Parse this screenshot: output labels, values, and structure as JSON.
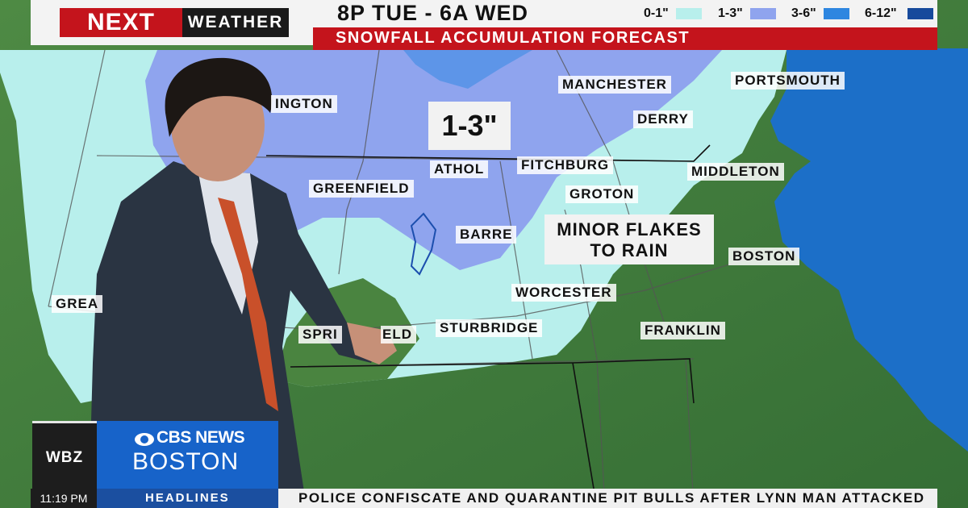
{
  "brand": {
    "next": "NEXT",
    "weather": "WEATHER",
    "station": "WBZ",
    "network_line1": "CBS NEWS",
    "network_line2": "BOSTON"
  },
  "forecast": {
    "time_range": "8P TUE - 6A WED",
    "subtitle": "SNOWFALL ACCUMULATION FORECAST",
    "big_callout": "1-3\"",
    "callout_line1": "MINOR FLAKES",
    "callout_line2": "TO RAIN"
  },
  "legend": [
    {
      "label": "0-1\"",
      "color": "#b8efec"
    },
    {
      "label": "1-3\"",
      "color": "#8fa4ee"
    },
    {
      "label": "3-6\"",
      "color": "#2e86e0"
    },
    {
      "label": "6-12\"",
      "color": "#174a9c"
    }
  ],
  "cities": {
    "bennington": "INGTON",
    "manchester": "MANCHESTER",
    "portsmouth": "PORTSMOUTH",
    "derry": "DERRY",
    "athol": "ATHOL",
    "fitchburg": "FITCHBURG",
    "middleton": "MIDDLETON",
    "greenfield": "GREENFIELD",
    "groton": "GROTON",
    "barre": "BARRE",
    "boston": "BOSTON",
    "worcester": "WORCESTER",
    "great_barrington": "GREA",
    "springfield": "SPRI",
    "springfield_end": "ELD",
    "sturbridge": "STURBRIDGE",
    "franklin": "FRANKLIN"
  },
  "ticker": {
    "time": "11:19 PM",
    "section": "HEADLINES",
    "headline": "POLICE CONFISCATE AND QUARANTINE PIT BULLS AFTER LYNN MAN ATTACKED"
  },
  "colors": {
    "brand_red": "#c4141c",
    "cbs_blue": "#1763c9",
    "land_green": "#3f7a3a",
    "ocean_blue": "#1c6fc8"
  }
}
